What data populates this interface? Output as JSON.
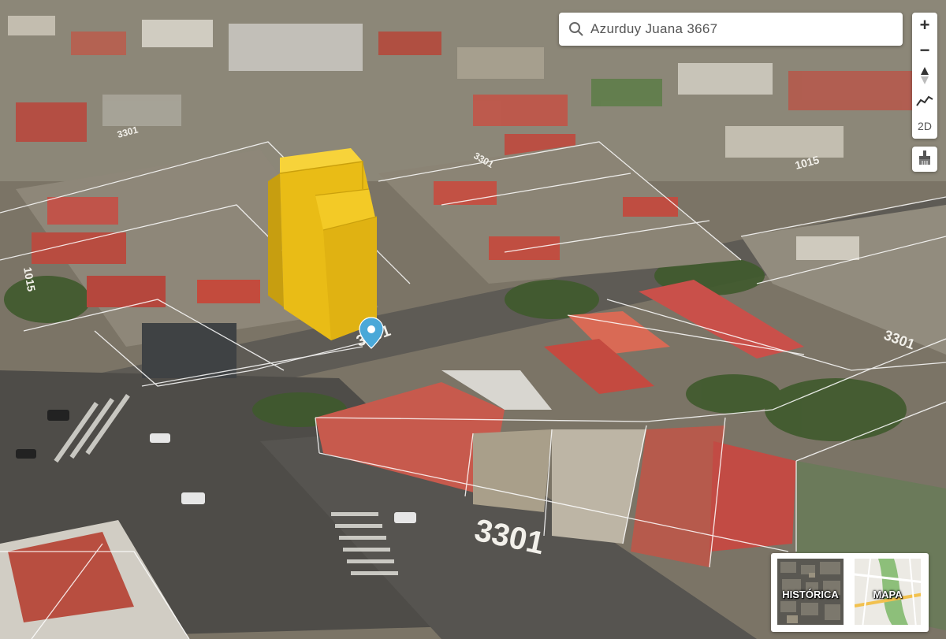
{
  "search": {
    "value": "Azurduy Juana 3667"
  },
  "controls": {
    "zoom_in": "+",
    "zoom_out": "−",
    "mode_toggle": "2D"
  },
  "icons": {
    "search": "search-icon",
    "compass": "compass-icon",
    "elevation": "elevation-profile-icon",
    "tool": "brush-tool-icon",
    "marker": "location-pin-icon"
  },
  "map": {
    "street_numbers": [
      "3301",
      "3301",
      "3301",
      "3301",
      "1015",
      "3301",
      "1015"
    ],
    "building_color": "#f0c419",
    "marker_color": "#4aa8d8"
  },
  "basemaps": [
    {
      "label": "HISTÓRICA"
    },
    {
      "label": "MAPA"
    }
  ]
}
